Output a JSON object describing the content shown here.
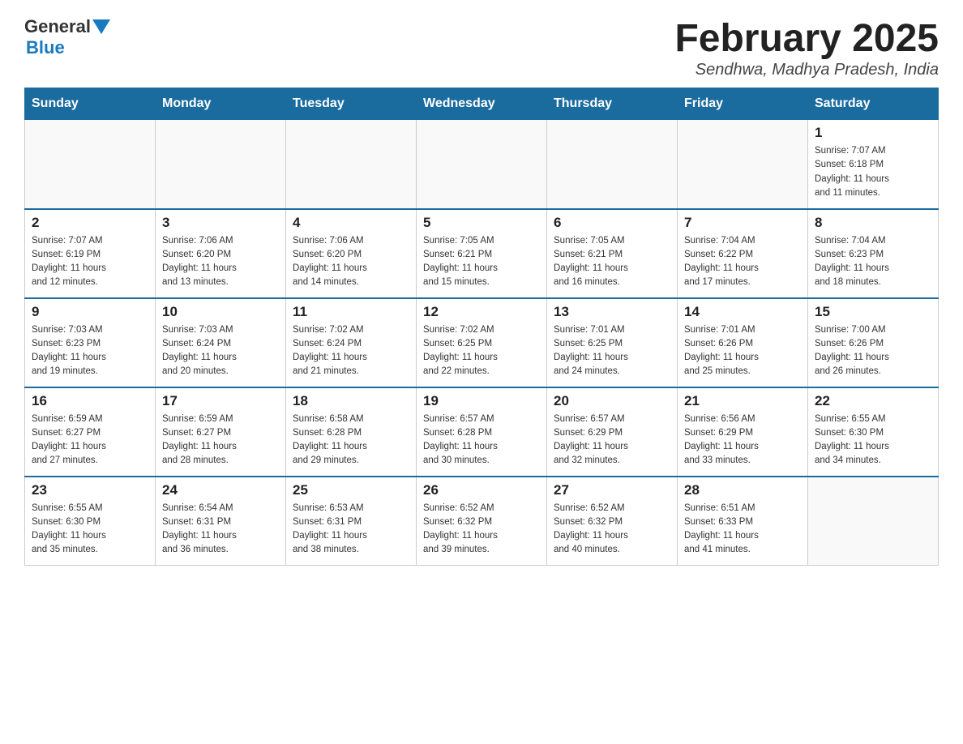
{
  "header": {
    "logo": {
      "text_general": "General",
      "text_blue": "Blue"
    },
    "title": "February 2025",
    "subtitle": "Sendhwa, Madhya Pradesh, India"
  },
  "weekdays": [
    "Sunday",
    "Monday",
    "Tuesday",
    "Wednesday",
    "Thursday",
    "Friday",
    "Saturday"
  ],
  "weeks": [
    [
      {
        "day": "",
        "info": ""
      },
      {
        "day": "",
        "info": ""
      },
      {
        "day": "",
        "info": ""
      },
      {
        "day": "",
        "info": ""
      },
      {
        "day": "",
        "info": ""
      },
      {
        "day": "",
        "info": ""
      },
      {
        "day": "1",
        "info": "Sunrise: 7:07 AM\nSunset: 6:18 PM\nDaylight: 11 hours\nand 11 minutes."
      }
    ],
    [
      {
        "day": "2",
        "info": "Sunrise: 7:07 AM\nSunset: 6:19 PM\nDaylight: 11 hours\nand 12 minutes."
      },
      {
        "day": "3",
        "info": "Sunrise: 7:06 AM\nSunset: 6:20 PM\nDaylight: 11 hours\nand 13 minutes."
      },
      {
        "day": "4",
        "info": "Sunrise: 7:06 AM\nSunset: 6:20 PM\nDaylight: 11 hours\nand 14 minutes."
      },
      {
        "day": "5",
        "info": "Sunrise: 7:05 AM\nSunset: 6:21 PM\nDaylight: 11 hours\nand 15 minutes."
      },
      {
        "day": "6",
        "info": "Sunrise: 7:05 AM\nSunset: 6:21 PM\nDaylight: 11 hours\nand 16 minutes."
      },
      {
        "day": "7",
        "info": "Sunrise: 7:04 AM\nSunset: 6:22 PM\nDaylight: 11 hours\nand 17 minutes."
      },
      {
        "day": "8",
        "info": "Sunrise: 7:04 AM\nSunset: 6:23 PM\nDaylight: 11 hours\nand 18 minutes."
      }
    ],
    [
      {
        "day": "9",
        "info": "Sunrise: 7:03 AM\nSunset: 6:23 PM\nDaylight: 11 hours\nand 19 minutes."
      },
      {
        "day": "10",
        "info": "Sunrise: 7:03 AM\nSunset: 6:24 PM\nDaylight: 11 hours\nand 20 minutes."
      },
      {
        "day": "11",
        "info": "Sunrise: 7:02 AM\nSunset: 6:24 PM\nDaylight: 11 hours\nand 21 minutes."
      },
      {
        "day": "12",
        "info": "Sunrise: 7:02 AM\nSunset: 6:25 PM\nDaylight: 11 hours\nand 22 minutes."
      },
      {
        "day": "13",
        "info": "Sunrise: 7:01 AM\nSunset: 6:25 PM\nDaylight: 11 hours\nand 24 minutes."
      },
      {
        "day": "14",
        "info": "Sunrise: 7:01 AM\nSunset: 6:26 PM\nDaylight: 11 hours\nand 25 minutes."
      },
      {
        "day": "15",
        "info": "Sunrise: 7:00 AM\nSunset: 6:26 PM\nDaylight: 11 hours\nand 26 minutes."
      }
    ],
    [
      {
        "day": "16",
        "info": "Sunrise: 6:59 AM\nSunset: 6:27 PM\nDaylight: 11 hours\nand 27 minutes."
      },
      {
        "day": "17",
        "info": "Sunrise: 6:59 AM\nSunset: 6:27 PM\nDaylight: 11 hours\nand 28 minutes."
      },
      {
        "day": "18",
        "info": "Sunrise: 6:58 AM\nSunset: 6:28 PM\nDaylight: 11 hours\nand 29 minutes."
      },
      {
        "day": "19",
        "info": "Sunrise: 6:57 AM\nSunset: 6:28 PM\nDaylight: 11 hours\nand 30 minutes."
      },
      {
        "day": "20",
        "info": "Sunrise: 6:57 AM\nSunset: 6:29 PM\nDaylight: 11 hours\nand 32 minutes."
      },
      {
        "day": "21",
        "info": "Sunrise: 6:56 AM\nSunset: 6:29 PM\nDaylight: 11 hours\nand 33 minutes."
      },
      {
        "day": "22",
        "info": "Sunrise: 6:55 AM\nSunset: 6:30 PM\nDaylight: 11 hours\nand 34 minutes."
      }
    ],
    [
      {
        "day": "23",
        "info": "Sunrise: 6:55 AM\nSunset: 6:30 PM\nDaylight: 11 hours\nand 35 minutes."
      },
      {
        "day": "24",
        "info": "Sunrise: 6:54 AM\nSunset: 6:31 PM\nDaylight: 11 hours\nand 36 minutes."
      },
      {
        "day": "25",
        "info": "Sunrise: 6:53 AM\nSunset: 6:31 PM\nDaylight: 11 hours\nand 38 minutes."
      },
      {
        "day": "26",
        "info": "Sunrise: 6:52 AM\nSunset: 6:32 PM\nDaylight: 11 hours\nand 39 minutes."
      },
      {
        "day": "27",
        "info": "Sunrise: 6:52 AM\nSunset: 6:32 PM\nDaylight: 11 hours\nand 40 minutes."
      },
      {
        "day": "28",
        "info": "Sunrise: 6:51 AM\nSunset: 6:33 PM\nDaylight: 11 hours\nand 41 minutes."
      },
      {
        "day": "",
        "info": ""
      }
    ]
  ]
}
